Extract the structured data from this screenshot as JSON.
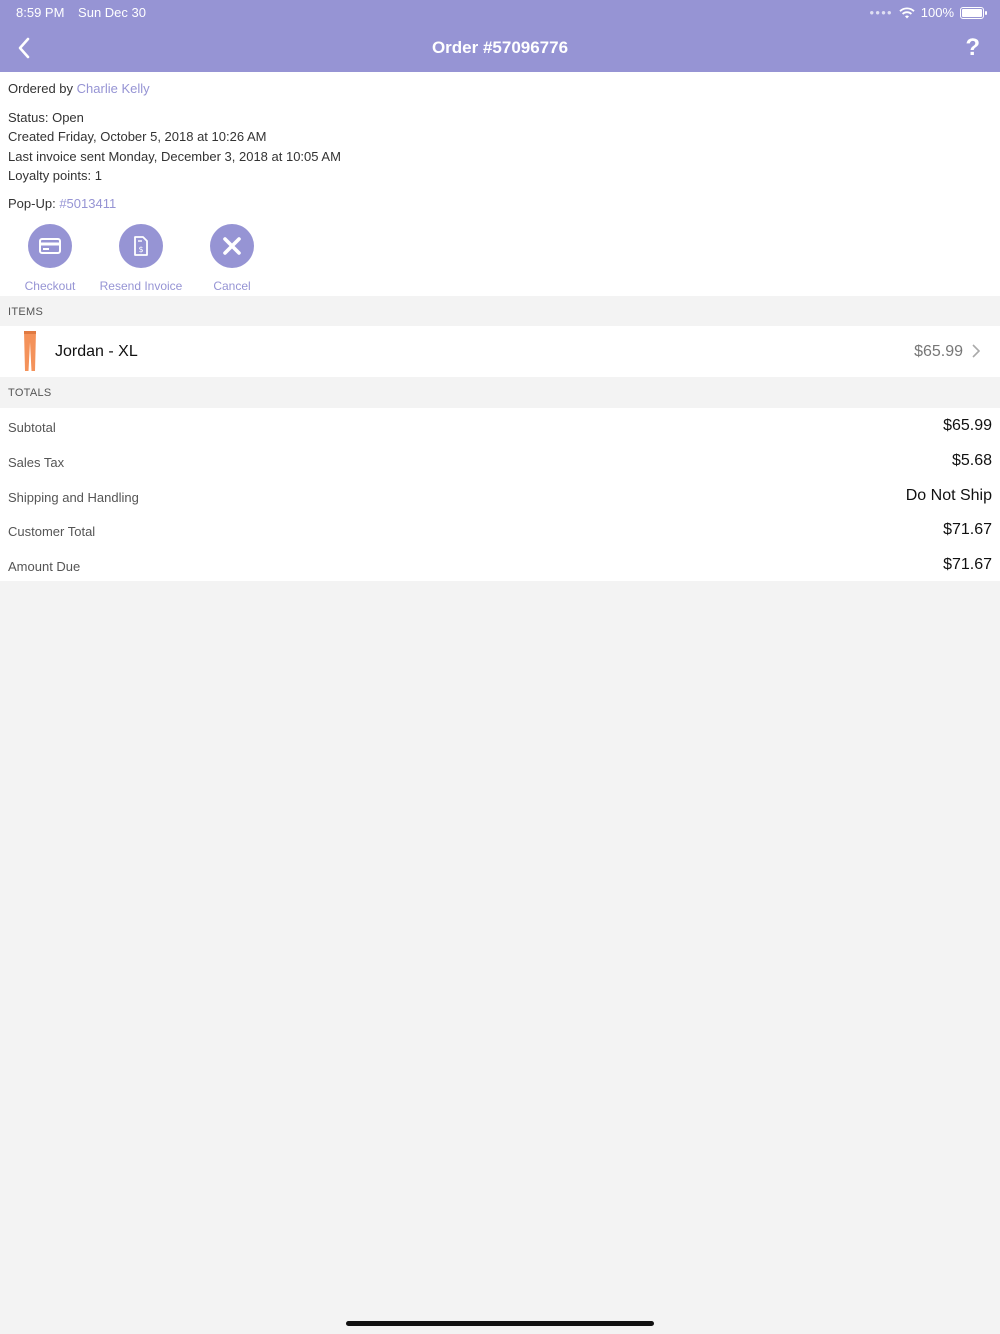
{
  "status_bar": {
    "time": "8:59 PM",
    "date": "Sun Dec 30",
    "battery": "100%"
  },
  "nav": {
    "title": "Order #57096776",
    "help_label": "?"
  },
  "order": {
    "ordered_by_label": "Ordered by ",
    "customer_name": "Charlie Kelly",
    "status": "Status: Open",
    "created": "Created Friday, October 5, 2018 at 10:26 AM",
    "last_invoice": "Last invoice sent Monday, December 3, 2018 at 10:05 AM",
    "loyalty": "Loyalty points: 1",
    "popup_label": "Pop-Up: ",
    "popup_id": "#5013411"
  },
  "actions": {
    "checkout": "Checkout",
    "resend_invoice": "Resend Invoice",
    "cancel": "Cancel"
  },
  "items_header": "ITEMS",
  "items": [
    {
      "name": "Jordan - XL",
      "price": "$65.99",
      "icon": "leggings-thumbnail"
    }
  ],
  "totals_header": "TOTALS",
  "totals": [
    {
      "label": "Subtotal",
      "value": "$65.99"
    },
    {
      "label": "Sales Tax",
      "value": "$5.68"
    },
    {
      "label": "Shipping and Handling",
      "value": "Do Not Ship"
    },
    {
      "label": "Customer Total",
      "value": "$71.67"
    },
    {
      "label": "Amount Due",
      "value": "$71.67"
    }
  ],
  "colors": {
    "accent": "#9694d4",
    "item_thumb": "#f4925a",
    "background": "#f3f3f3"
  }
}
